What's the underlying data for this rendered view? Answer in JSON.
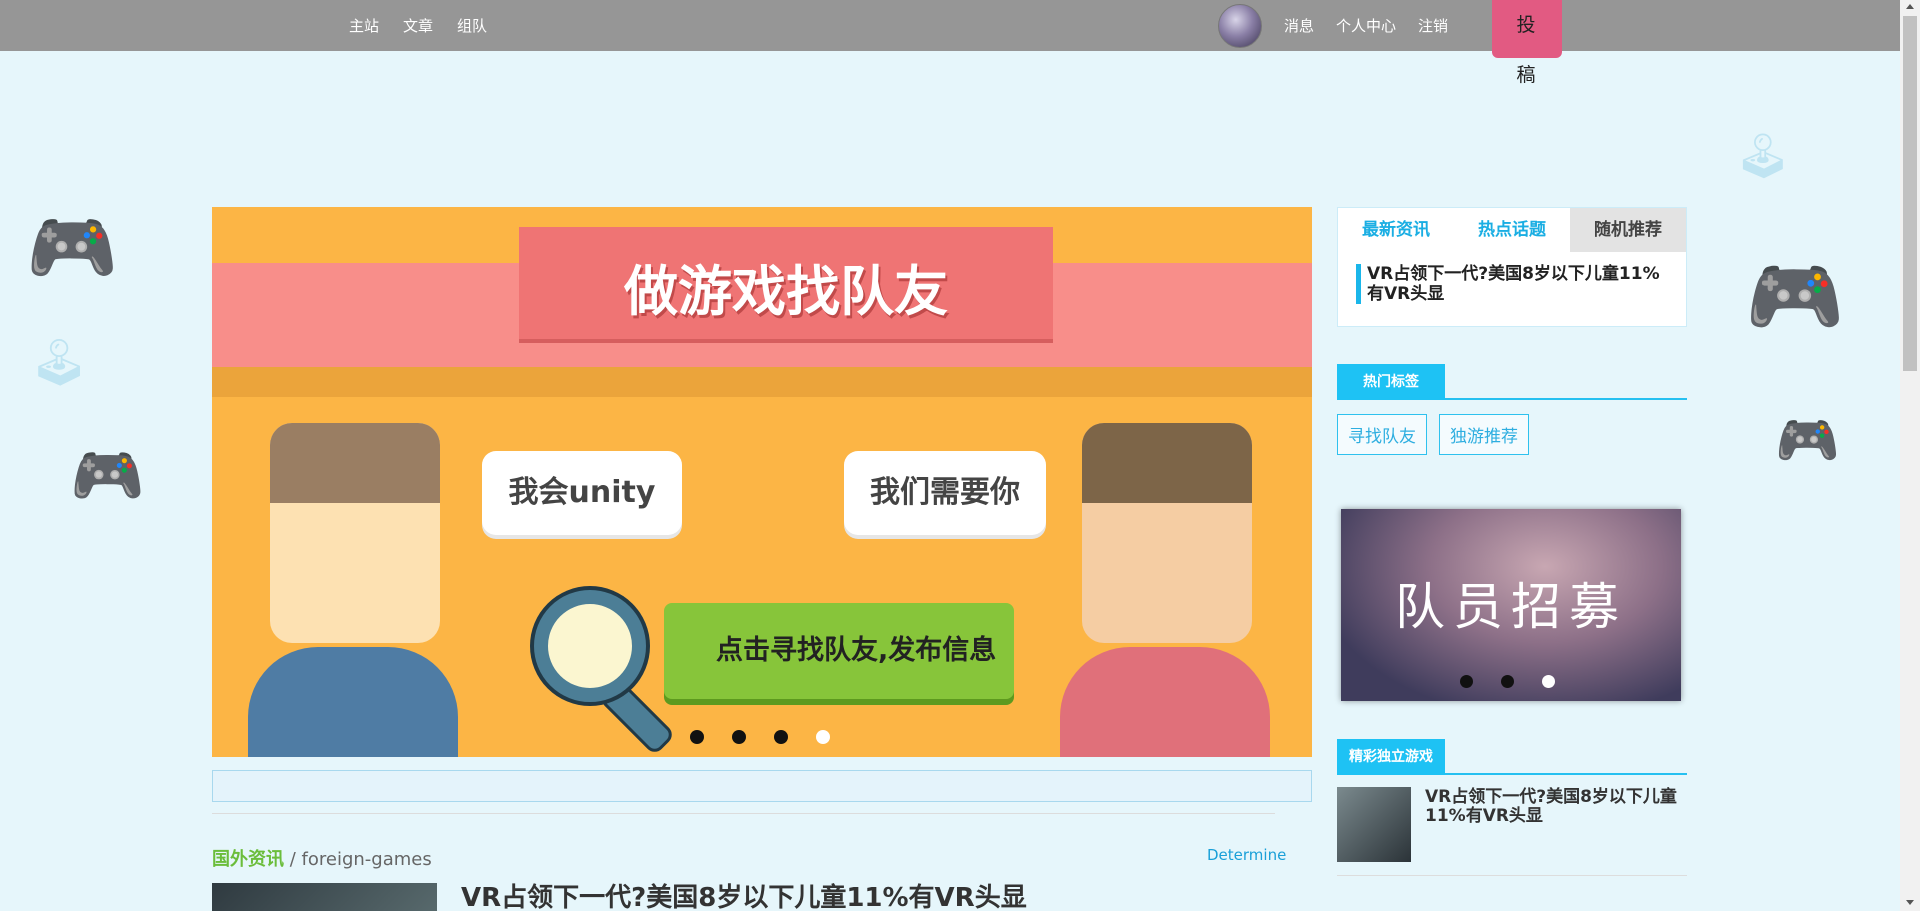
{
  "nav": {
    "home": "主站",
    "articles": "文章",
    "team": "组队",
    "messages": "消息",
    "profile": "个人中心",
    "logout": "注销",
    "post": "投 稿"
  },
  "banner": {
    "title": "做游戏找队友",
    "bubble_left": "我会unity",
    "bubble_right": "我们需要你",
    "cta": "点击寻找队友,发布信息",
    "slide_count": 4,
    "active_slide": 4
  },
  "section": {
    "title": "国外资讯",
    "subtitle": "/ foreign-games",
    "more_link": "Determine",
    "article_title": "VR占领下一代?美国8岁以下儿童11%有VR头显"
  },
  "sidebar": {
    "tabs": [
      "最新资讯",
      "热点话题",
      "随机推荐"
    ],
    "active_tab": "随机推荐",
    "news_item": "VR占领下一代?美国8岁以下儿童11%有VR头显",
    "hot_tags_title": "热门标签",
    "tags": [
      "寻找队友",
      "独游推荐"
    ],
    "recruit_title": "队员招募",
    "recruit_slide_count": 3,
    "recruit_active_slide": 3,
    "indie_title": "精彩独立游戏",
    "indie_item": "VR占领下一代?美国8岁以下儿童11%有VR头显"
  },
  "colors": {
    "nav_bg": "#969696",
    "post_button": "#e25a82",
    "accent": "#1ec2f4",
    "section_green": "#6bbd3b",
    "banner_bg": "#fcb545"
  },
  "icons": {
    "decorations": "gamepad-icon",
    "scroll_up": "scroll-up-arrow-icon",
    "scroll_down": "scroll-down-arrow-icon"
  }
}
